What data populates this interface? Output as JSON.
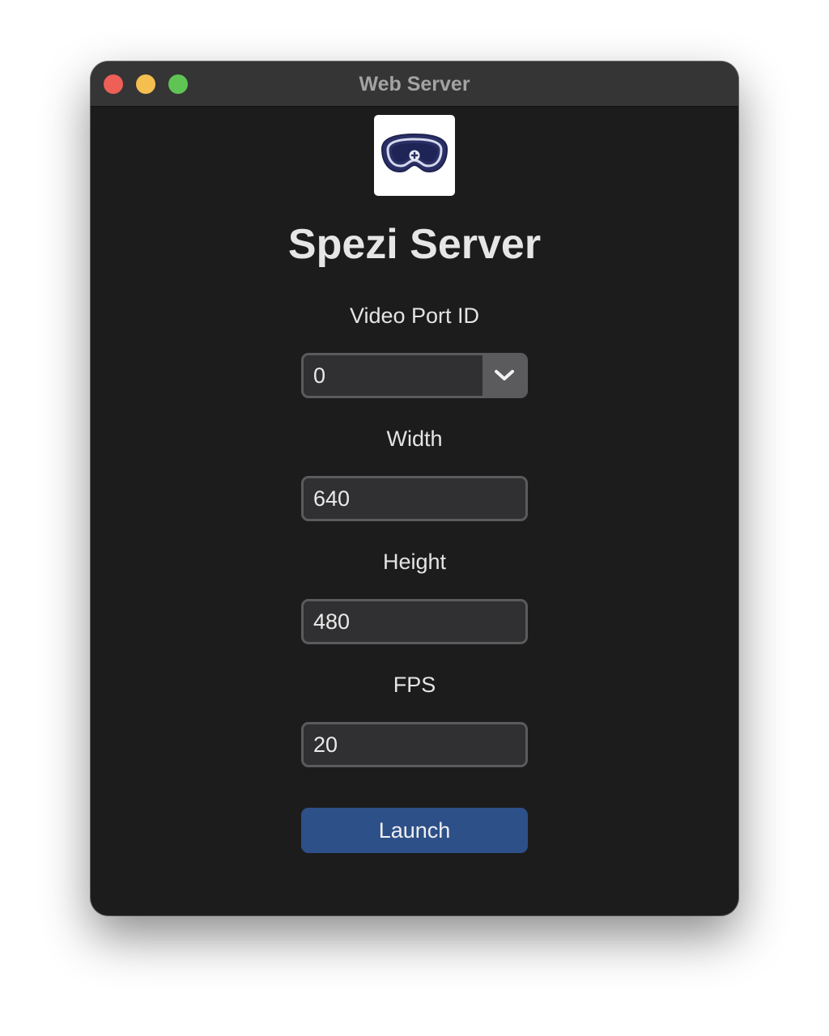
{
  "window": {
    "title": "Web Server",
    "controls": [
      "close",
      "minimize",
      "zoom"
    ]
  },
  "app": {
    "logo_icon": "vr-headset-medical-icon",
    "title": "Spezi Server"
  },
  "form": {
    "video_port": {
      "label": "Video Port ID",
      "value": "0",
      "icon": "chevron-down-icon"
    },
    "width": {
      "label": "Width",
      "value": "640"
    },
    "height": {
      "label": "Height",
      "value": "480"
    },
    "fps": {
      "label": "FPS",
      "value": "20"
    },
    "launch_label": "Launch"
  },
  "colors": {
    "window_bg": "#1c1c1c",
    "titlebar_bg": "#353535",
    "field_bg": "#303032",
    "field_border": "#5b5b5d",
    "button_accent": "#2e5089",
    "close": "#ee5f57",
    "minimize": "#f4bf4f",
    "zoom": "#5fc454"
  }
}
